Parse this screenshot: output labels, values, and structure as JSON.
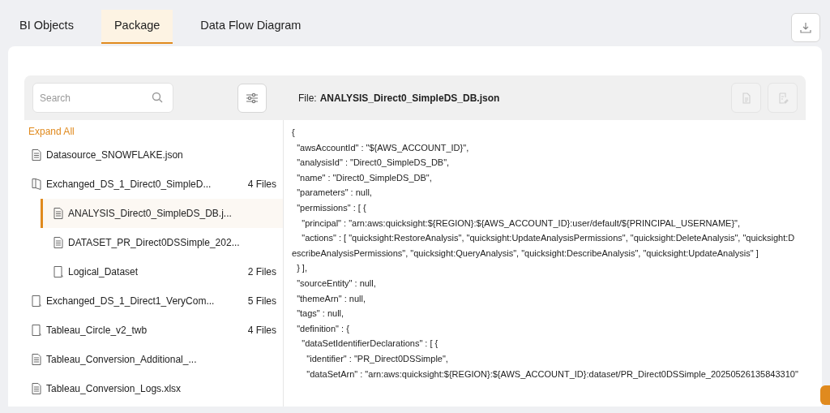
{
  "tabs": [
    {
      "label": "BI Objects",
      "selected": false
    },
    {
      "label": "Package",
      "selected": true
    },
    {
      "label": "Data Flow Diagram",
      "selected": false
    }
  ],
  "search": {
    "placeholder": "Search"
  },
  "file_header": {
    "label": "File:",
    "name": "ANALYSIS_Direct0_SimpleDS_DB.json"
  },
  "header_actions": [
    {
      "kind": "document",
      "disabled": true
    },
    {
      "kind": "edit",
      "disabled": true
    }
  ],
  "expand_all": "Expand All",
  "tree": [
    {
      "kind": "file",
      "label": "Datasource_SNOWFLAKE.json",
      "selected": false
    },
    {
      "kind": "folder",
      "label": "Exchanged_DS_1_Direct0_SimpleD...",
      "count": "4 Files",
      "expanded": true,
      "selected": false,
      "children": [
        {
          "kind": "file",
          "label": "ANALYSIS_Direct0_SimpleDS_DB.j...",
          "selected": true
        },
        {
          "kind": "file",
          "label": "DATASET_PR_Direct0DSSimple_202...",
          "selected": false
        },
        {
          "kind": "folder",
          "label": "Logical_Dataset",
          "count": "2 Files",
          "expanded": false,
          "selected": false
        }
      ]
    },
    {
      "kind": "folder",
      "label": "Exchanged_DS_1_Direct1_VeryCom...",
      "count": "5 Files",
      "expanded": false,
      "selected": false
    },
    {
      "kind": "folder",
      "label": "Tableau_Circle_v2_twb",
      "count": "4 Files",
      "expanded": false,
      "selected": false
    },
    {
      "kind": "file",
      "label": "Tableau_Conversion_Additional_...",
      "selected": false
    },
    {
      "kind": "file",
      "label": "Tableau_Conversion_Logs.xlsx",
      "selected": false
    }
  ],
  "code_lines": [
    "{",
    "  \"awsAccountId\" : \"${AWS_ACCOUNT_ID}\",",
    "  \"analysisId\" : \"Direct0_SimpleDS_DB\",",
    "  \"name\" : \"Direct0_SimpleDS_DB\",",
    "  \"parameters\" : null,",
    "  \"permissions\" : [ {",
    "    \"principal\" : \"arn:aws:quicksight:${REGION}:${AWS_ACCOUNT_ID}:user/default/${PRINCIPAL_USERNAME}\",",
    "    \"actions\" : [ \"quicksight:RestoreAnalysis\", \"quicksight:UpdateAnalysisPermissions\", \"quicksight:DeleteAnalysis\", \"quicksight:DescribeAnalysisPermissions\", \"quicksight:QueryAnalysis\", \"quicksight:DescribeAnalysis\", \"quicksight:UpdateAnalysis\" ]",
    "  } ],",
    "  \"sourceEntity\" : null,",
    "  \"themeArn\" : null,",
    "  \"tags\" : null,",
    "  \"definition\" : {",
    "    \"dataSetIdentifierDeclarations\" : [ {",
    "      \"identifier\" : \"PR_Direct0DSSimple\",",
    "      \"dataSetArn\" : \"arn:aws:quicksight:${REGION}:${AWS_ACCOUNT_ID}:dataset/PR_Direct0DSSimple_20250526135843310\""
  ]
}
